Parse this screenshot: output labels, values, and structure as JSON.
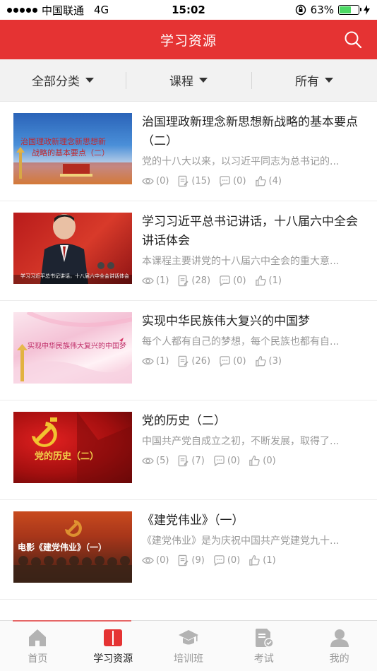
{
  "status_bar": {
    "carrier": "中国联通",
    "network": "4G",
    "time": "15:02",
    "battery": "63%",
    "battery_level": 0.63
  },
  "header": {
    "title": "学习资源",
    "search_icon": "search-icon"
  },
  "filters": [
    {
      "label": "全部分类"
    },
    {
      "label": "课程"
    },
    {
      "label": "所有"
    }
  ],
  "courses": [
    {
      "title": "治国理政新理念新思想新战略的基本要点（二）",
      "desc": "党的十八大以来，以习近平同志为总书记的...",
      "views": "(0)",
      "exams": "(15)",
      "comments": "(0)",
      "likes": "(4)",
      "thumb_text": [
        "治国理政新理念新思想新",
        "战略的基本要点（二）"
      ]
    },
    {
      "title": "学习习近平总书记讲话，十八届六中全会讲话体会",
      "desc": "本课程主要讲党的十八届六中全会的重大意...",
      "views": "(1)",
      "exams": "(28)",
      "comments": "(0)",
      "likes": "(1)",
      "thumb_text": [
        "学习习近平总书记讲话，十八届六中全会讲话体会"
      ]
    },
    {
      "title": "实现中华民族伟大复兴的中国梦",
      "desc": "每个人都有自己的梦想，每个民族也都有自...",
      "views": "(1)",
      "exams": "(26)",
      "comments": "(0)",
      "likes": "(3)",
      "thumb_text": [
        "实现中华民族伟大复兴的中国梦"
      ]
    },
    {
      "title": "党的历史（二）",
      "desc": "中国共产党自成立之初，不断发展，取得了...",
      "views": "(5)",
      "exams": "(7)",
      "comments": "(0)",
      "likes": "(0)",
      "thumb_text": [
        "党的历史（二）"
      ]
    },
    {
      "title": "《建党伟业》（一）",
      "desc": "《建党伟业》是为庆祝中国共产党建党九十...",
      "views": "(0)",
      "exams": "(9)",
      "comments": "(0)",
      "likes": "(1)",
      "thumb_text": [
        "电影《建党伟业》（一）"
      ]
    }
  ],
  "tabs": [
    {
      "label": "首页",
      "icon": "home-icon"
    },
    {
      "label": "学习资源",
      "icon": "book-icon",
      "active": true
    },
    {
      "label": "培训班",
      "icon": "graduation-cap-icon"
    },
    {
      "label": "考试",
      "icon": "exam-icon"
    },
    {
      "label": "我的",
      "icon": "user-icon"
    }
  ],
  "colors": {
    "brand": "#e53333",
    "tab_active": "#e53333",
    "tab_inactive": "#b3b3b3"
  }
}
